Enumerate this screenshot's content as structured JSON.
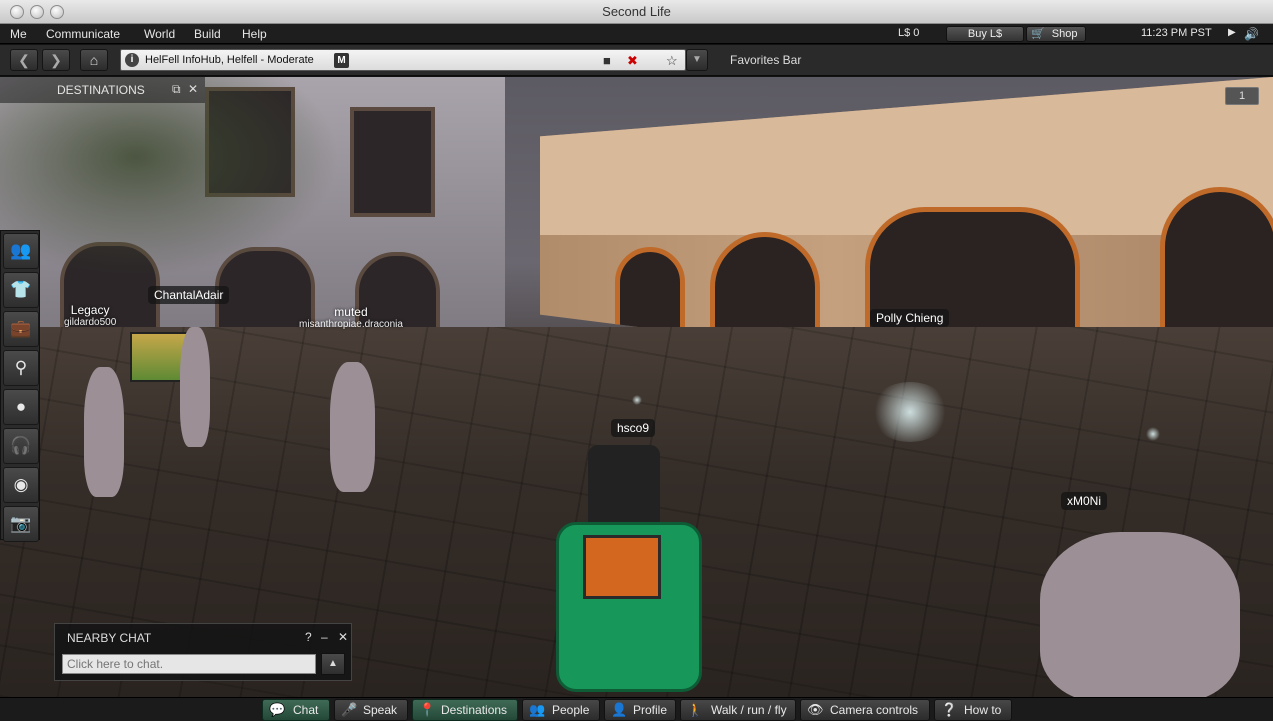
{
  "window": {
    "title": "Second Life"
  },
  "menubar": {
    "items": [
      "Me",
      "Communicate",
      "World",
      "Build",
      "Help"
    ],
    "balance": "L$ 0",
    "buy_label": "Buy L$",
    "shop_label": "Shop",
    "clock": "11:23 PM PST"
  },
  "navbar": {
    "location": "HelFell InfoHub, Helfell - Moderate",
    "maturity_badge": "M",
    "favorites_label": "Favorites Bar"
  },
  "scene": {
    "slurl_badge": "1",
    "avatars": [
      {
        "name": "Legacy",
        "sub": "gildardo500"
      },
      {
        "name": "ChantalAdair"
      },
      {
        "name": "muted",
        "sub": "misanthropiae.draconia"
      },
      {
        "name": "Polly Chieng"
      },
      {
        "name": "hsco9"
      },
      {
        "name": "xM0Ni"
      }
    ]
  },
  "destinations": {
    "title": "DESTINATIONS"
  },
  "nearby_chat": {
    "title": "NEARBY CHAT",
    "help": "?",
    "minimize": "–",
    "close": "✕",
    "placeholder": "Click here to chat."
  },
  "bottombar": {
    "buttons": [
      {
        "label": "Chat",
        "icon": "speech-bubble-icon",
        "active": true
      },
      {
        "label": "Speak",
        "icon": "microphone-icon",
        "active": false
      },
      {
        "label": "Destinations",
        "icon": "map-pin-icon",
        "active": true
      },
      {
        "label": "People",
        "icon": "people-icon",
        "active": false
      },
      {
        "label": "Profile",
        "icon": "profile-card-icon",
        "active": false
      },
      {
        "label": "Walk / run / fly",
        "icon": "walking-icon",
        "active": false
      },
      {
        "label": "Camera controls",
        "icon": "eye-icon",
        "active": false
      },
      {
        "label": "How to",
        "icon": "question-book-icon",
        "active": false
      }
    ]
  }
}
